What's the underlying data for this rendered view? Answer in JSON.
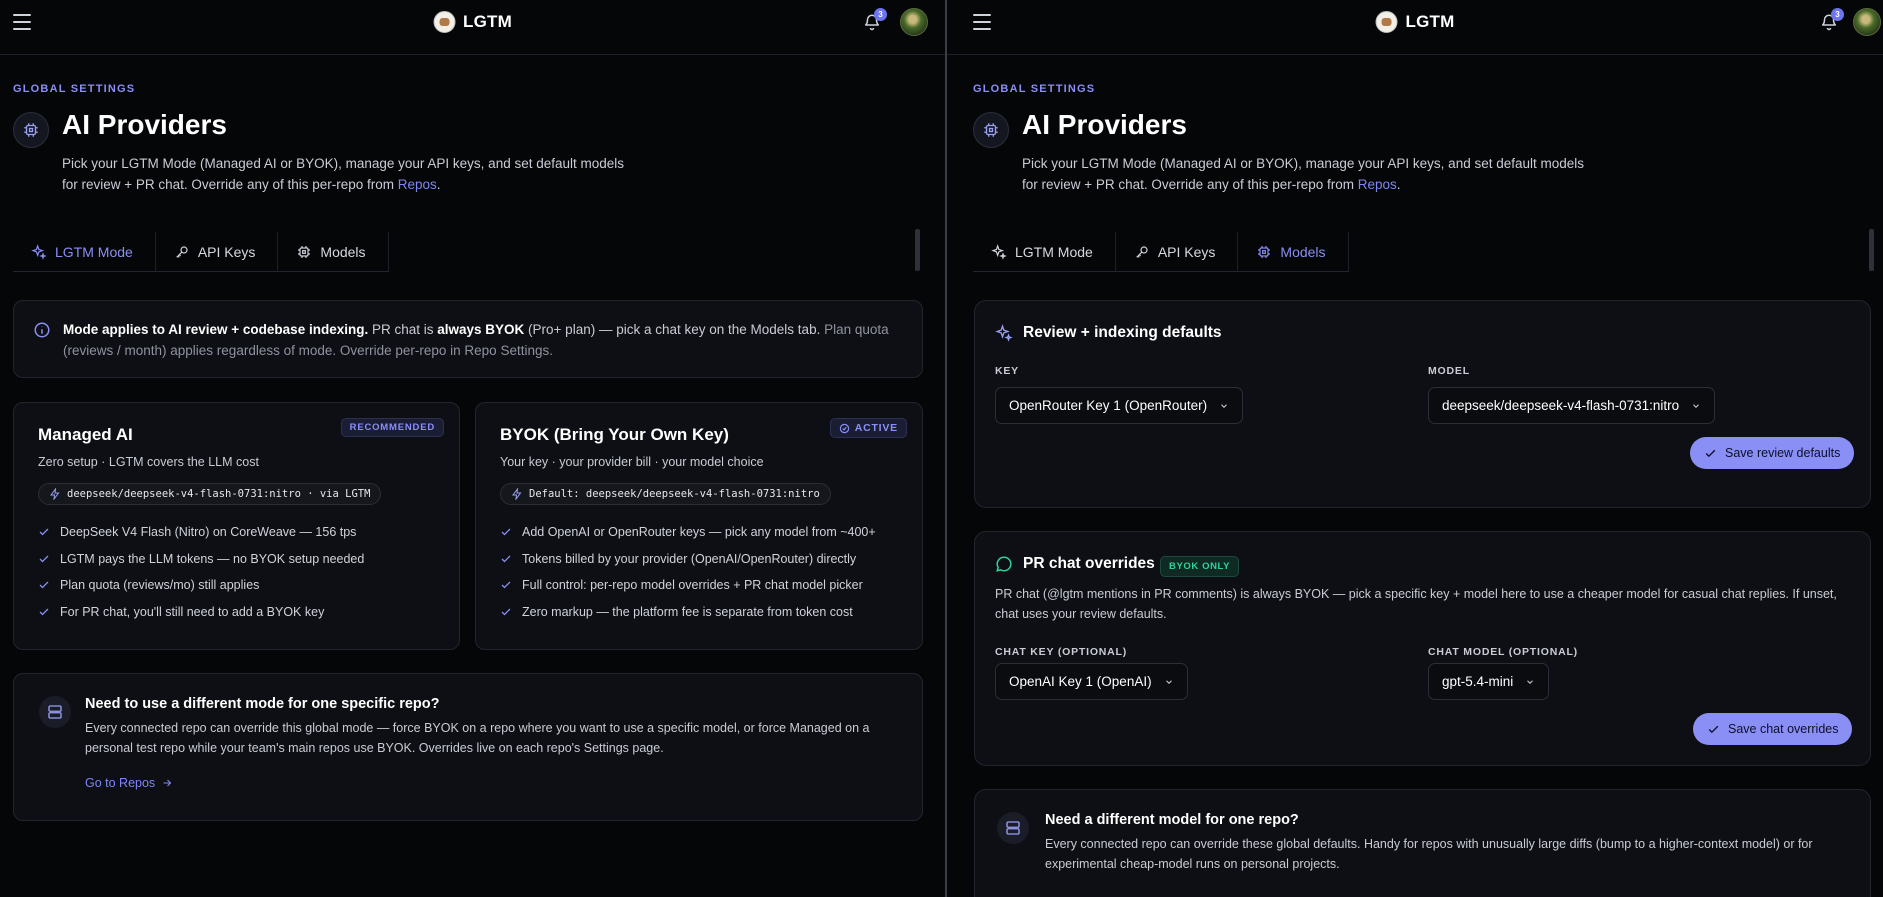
{
  "app": {
    "name": "LGTM",
    "notification_count": "3"
  },
  "header": {
    "eyebrow": "GLOBAL SETTINGS",
    "title": "AI Providers",
    "desc_before": "Pick your LGTM Mode (Managed AI or BYOK), manage your API keys, and set default models for review + PR chat. Override any of this per-repo from ",
    "desc_link": "Repos",
    "desc_after": "."
  },
  "tabs": {
    "lgtm_mode": "LGTM Mode",
    "api_keys": "API Keys",
    "models": "Models"
  },
  "left": {
    "info": {
      "bold": "Mode applies to AI review + codebase indexing.",
      "t1": " PR chat is ",
      "bold2": "always BYOK",
      "t2": " (Pro+ plan) — pick a chat key on the Models tab. ",
      "muted": "Plan quota (reviews / month) applies regardless of mode. Override per-repo in Repo Settings."
    },
    "managed": {
      "title": "Managed AI",
      "badge": "RECOMMENDED",
      "subtitle": "Zero setup · LGTM covers the LLM cost",
      "chip": "deepseek/deepseek-v4-flash-0731:nitro · via LGTM",
      "bullets": [
        "DeepSeek V4 Flash (Nitro) on CoreWeave — 156 tps",
        "LGTM pays the LLM tokens — no BYOK setup needed",
        "Plan quota (reviews/mo) still applies",
        "For PR chat, you'll still need to add a BYOK key"
      ]
    },
    "byok": {
      "title": "BYOK (Bring Your Own Key)",
      "badge": "ACTIVE",
      "subtitle": "Your key · your provider bill · your model choice",
      "chip": "Default: deepseek/deepseek-v4-flash-0731:nitro",
      "bullets": [
        "Add OpenAI or OpenRouter keys — pick any model from ~400+",
        "Tokens billed by your provider (OpenAI/OpenRouter) directly",
        "Full control: per-repo model overrides + PR chat model picker",
        "Zero markup — the platform fee is separate from token cost"
      ]
    },
    "note": {
      "title": "Need to use a different mode for one specific repo?",
      "text": "Every connected repo can override this global mode — force BYOK on a repo where you want to use a specific model, or force Managed on a personal test repo while your team's main repos use BYOK. Overrides live on each repo's Settings page.",
      "link": "Go to Repos"
    }
  },
  "right": {
    "review": {
      "title": "Review + indexing defaults",
      "key_label": "KEY",
      "key_value": "OpenRouter Key 1 (OpenRouter)",
      "model_label": "MODEL",
      "model_value": "deepseek/deepseek-v4-flash-0731:nitro",
      "save": "Save review defaults"
    },
    "chat": {
      "title": "PR chat overrides",
      "badge": "BYOK ONLY",
      "desc": "PR chat (@lgtm mentions in PR comments) is always BYOK — pick a specific key + model here to use a cheaper model for casual chat replies. If unset, chat uses your review defaults.",
      "key_label": "CHAT KEY (OPTIONAL)",
      "key_value": "OpenAI Key 1 (OpenAI)",
      "model_label": "CHAT MODEL (OPTIONAL)",
      "model_value": "gpt-5.4-mini",
      "save": "Save chat overrides"
    },
    "note": {
      "title": "Need a different model for one repo?",
      "text": "Every connected repo can override these global defaults. Handy for repos with unusually large diffs (bump to a higher-context model) or for experimental cheap-model runs on personal projects."
    }
  },
  "colors": {
    "accent": "#8a8ff5",
    "background": "#050608",
    "card": "#0d0f14",
    "success": "#2fd39a"
  },
  "icons": [
    "menu-icon",
    "bell-icon",
    "chip-icon",
    "sparkle-icon",
    "key-icon",
    "cog-icon",
    "info-icon",
    "check-icon",
    "check-circle-icon",
    "bolt-icon",
    "server-icon",
    "arrow-right-icon",
    "chat-bubble-icon",
    "chevron-down-icon"
  ]
}
